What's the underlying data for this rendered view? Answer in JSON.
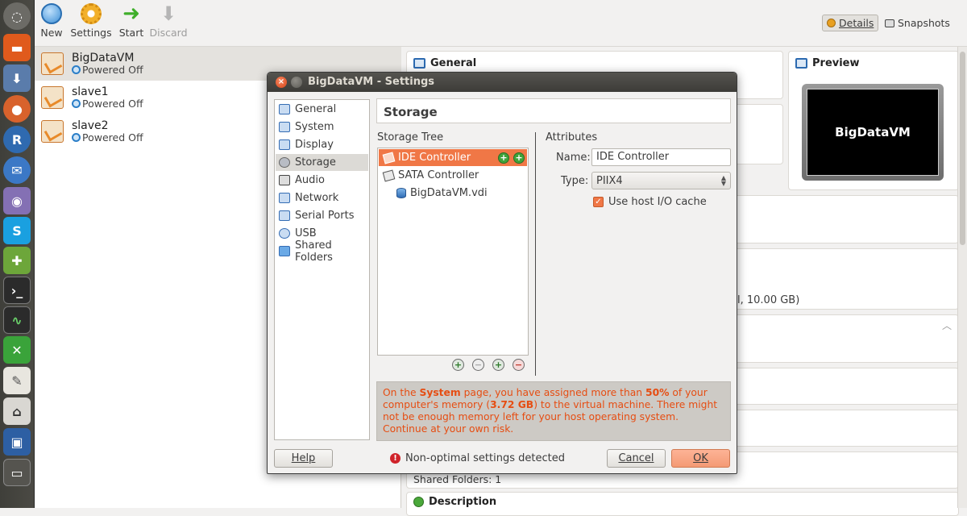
{
  "toolbar": {
    "new_label": "New",
    "settings_label": "Settings",
    "start_label": "Start",
    "discard_label": "Discard",
    "details_label": "Details",
    "snapshots_label": "Snapshots"
  },
  "vm_list": [
    {
      "name": "BigDataVM",
      "state": "Powered Off"
    },
    {
      "name": "slave1",
      "state": "Powered Off"
    },
    {
      "name": "slave2",
      "state": "Powered Off"
    }
  ],
  "details": {
    "general_title": "General",
    "preview_title": "Preview",
    "preview_screen_text": "BigDataVM",
    "storage_fragment": "l, 10.00 GB)",
    "shared_folders": "Shared Folders: 1",
    "description_title": "Description"
  },
  "dialog": {
    "title": "BigDataVM - Settings",
    "categories": [
      "General",
      "System",
      "Display",
      "Storage",
      "Audio",
      "Network",
      "Serial Ports",
      "USB",
      "Shared Folders"
    ],
    "selected_category": "Storage",
    "page_title": "Storage",
    "storage_tree_label": "Storage Tree",
    "tree": [
      {
        "label": "IDE Controller"
      },
      {
        "label": "SATA Controller"
      },
      {
        "label": "BigDataVM.vdi"
      }
    ],
    "attributes_label": "Attributes",
    "name_label": "Name:",
    "name_value": "IDE Controller",
    "type_label": "Type:",
    "type_value": "PIIX4",
    "host_io_label": "Use host I/O cache",
    "warning": {
      "p1": "On the ",
      "b1": "System",
      "p2": " page, you have assigned more than ",
      "b2": "50%",
      "p3": " of your computer's memory (",
      "b3": "3.72 GB",
      "p4": ") to the virtual machine. There might not be enough memory left for your host operating system. Continue at your own risk."
    },
    "help_label": "Help",
    "status_text": "Non-optimal settings detected",
    "cancel_label": "Cancel",
    "ok_label": "OK"
  },
  "colors": {
    "accent": "#f07746",
    "warning_text": "#e64d12",
    "launcher_bg": "#3f3f3a"
  }
}
